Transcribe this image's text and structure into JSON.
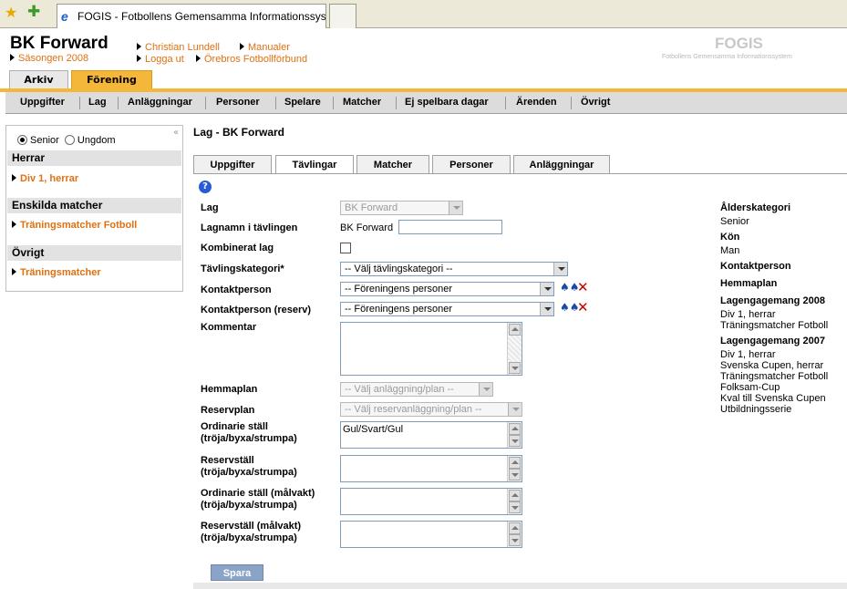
{
  "browser": {
    "tab_title": "FOGIS - Fotbollens Gemensamma Informationssystem"
  },
  "header": {
    "club": "BK Forward",
    "season": "Säsongen 2008",
    "links": {
      "user": "Christian Lundell",
      "manuals": "Manualer",
      "logout": "Logga ut",
      "federation": "Örebros Fotbollförbund"
    },
    "logo": "FOGIS",
    "logo_sub": "Fotbollens Gemensamma Informationssystem"
  },
  "top_tabs": {
    "arkiv": "Arkiv",
    "forening": "Förening"
  },
  "menu": {
    "items": [
      "Uppgifter",
      "Lag",
      "Anläggningar",
      "Personer",
      "Spelare",
      "Matcher",
      "Ej spelbara dagar",
      "Ärenden",
      "Övrigt"
    ]
  },
  "sidebar": {
    "radio_senior": "Senior",
    "radio_ungdom": "Ungdom",
    "collapse": "«",
    "sections": [
      {
        "title": "Herrar",
        "item": "Div 1, herrar"
      },
      {
        "title": "Enskilda matcher",
        "item": "Träningsmatcher Fotboll"
      },
      {
        "title": "Övrigt",
        "item": "Träningsmatcher"
      }
    ]
  },
  "main": {
    "title": "Lag - BK Forward",
    "tabs": [
      "Uppgifter",
      "Tävlingar",
      "Matcher",
      "Personer",
      "Anläggningar"
    ],
    "active_tab": "Tävlingar",
    "help": "?"
  },
  "form": {
    "lag_label": "Lag",
    "lag_value": "BK Forward",
    "lagnamn_label": "Lagnamn i tävlingen",
    "lagnamn_value": "BK Forward",
    "kombinerat_label": "Kombinerat lag",
    "kategori_label": "Tävlingskategori*",
    "kategori_value": "-- Välj tävlingskategori --",
    "kontakt_label": "Kontaktperson",
    "kontakt_value": "-- Föreningens personer",
    "kontakt_reserv_label": "Kontaktperson (reserv)",
    "kontakt_reserv_value": "-- Föreningens personer",
    "kommentar_label": "Kommentar",
    "hemmaplan_label": "Hemmaplan",
    "hemmaplan_value": "-- Välj anläggning/plan --",
    "reservplan_label": "Reservplan",
    "reservplan_value": "-- Välj reservanläggning/plan --",
    "ord_stall_label_1": "Ordinarie ställ",
    "ord_stall_label_2": "(tröja/byxa/strumpa)",
    "ord_stall_value": "Gul/Svart/Gul",
    "res_stall_label_1": "Reservställ",
    "res_stall_label_2": "(tröja/byxa/strumpa)",
    "ord_mv_label_1": "Ordinarie ställ (målvakt)",
    "ord_mv_label_2": "(tröja/byxa/strumpa)",
    "res_mv_label_1": "Reservställ (målvakt)",
    "res_mv_label_2": "(tröja/byxa/strumpa)",
    "save": "Spara"
  },
  "info": {
    "alder_label": "Ålderskategori",
    "alder_value": "Senior",
    "kon_label": "Kön",
    "kon_value": "Man",
    "kontakt_label": "Kontaktperson",
    "hemmaplan_label": "Hemmaplan",
    "eng2008_label": "Lagengagemang 2008",
    "eng2008": [
      "Div 1, herrar",
      "Träningsmatcher Fotboll"
    ],
    "eng2007_label": "Lagengagemang 2007",
    "eng2007": [
      "Div 1, herrar",
      "Svenska Cupen, herrar",
      "Träningsmatcher Fotboll",
      "Folksam-Cup",
      "Kval till Svenska Cupen",
      "Utbildningsserie"
    ]
  },
  "colors": {
    "accent": "#f5b73a",
    "link": "#e07010",
    "delete": "#cc0000"
  }
}
